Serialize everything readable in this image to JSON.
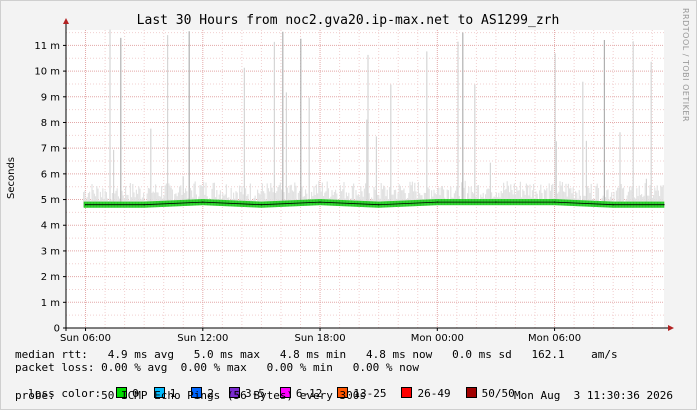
{
  "chart_data": {
    "type": "line",
    "title": "Last 30 Hours from noc2.gva20.ip-max.net to AS1299_zrh",
    "ylabel": "Seconds",
    "yticks": [
      "0",
      "1 m",
      "2 m",
      "3 m",
      "4 m",
      "5 m",
      "6 m",
      "7 m",
      "8 m",
      "9 m",
      "10 m",
      "11 m"
    ],
    "ylim": [
      0,
      0.0116
    ],
    "xticks": [
      "Sun 06:00",
      "Sun 12:00",
      "Sun 18:00",
      "Mon 00:00",
      "Mon 06:00"
    ],
    "xlim_hours": [
      -1,
      29.6
    ],
    "grid": true,
    "series": [
      {
        "name": "median rtt",
        "color": "#000000",
        "band_color": "#22cc22",
        "x_hours": [
          0,
          3,
          6,
          9,
          12,
          15,
          18,
          21,
          24,
          27,
          29.6
        ],
        "values": [
          0.0048,
          0.0048,
          0.0049,
          0.0048,
          0.0049,
          0.0048,
          0.0049,
          0.0049,
          0.0049,
          0.0048,
          0.0048
        ]
      }
    ]
  },
  "stats": {
    "median_rtt": "median rtt:   4.9 ms avg   5.0 ms max   4.8 ms min   4.8 ms now   0.0 ms sd   162.1    am/s",
    "packet_loss": "packet loss: 0.00 % avg  0.00 % max   0.00 % min   0.00 % now",
    "loss_color_label": "loss color:",
    "loss_colors": [
      {
        "label": "0",
        "color": "#00dd00"
      },
      {
        "label": "1",
        "color": "#00bbff"
      },
      {
        "label": "2",
        "color": "#0066ff"
      },
      {
        "label": "3-5",
        "color": "#7b2ad1"
      },
      {
        "label": "6-12",
        "color": "#ff00ff"
      },
      {
        "label": "13-25",
        "color": "#ff5500"
      },
      {
        "label": "26-49",
        "color": "#ff0000"
      },
      {
        "label": "50/50",
        "color": "#a00000"
      }
    ],
    "probe": "probe:       50 ICMP Echo Pings (56 Bytes) every 300s",
    "timestamp": "Mon Aug  3 11:30:36 2026"
  },
  "watermark": "RRDTOOL / TOBI OETIKER"
}
